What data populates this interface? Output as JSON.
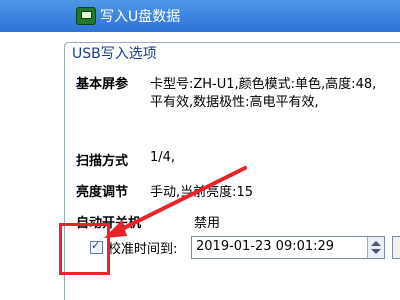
{
  "window": {
    "title": "写入U盘数据",
    "icon": "app-icon"
  },
  "group": {
    "title": "USB写入选项"
  },
  "fields": {
    "basic_params": {
      "label": "基本屏参",
      "value_line1": "卡型号:ZH-U1,颜色模式:单色,高度:48,",
      "value_line2": "平有效,数据极性:高电平有效,"
    },
    "scan_mode": {
      "label": "扫描方式",
      "value": "1/4,"
    },
    "brightness": {
      "label": "亮度调节",
      "value": "手动,当前亮度:15"
    },
    "auto_onoff": {
      "label": "自动开关机",
      "value": "禁用"
    }
  },
  "calibrate": {
    "checked": true,
    "label": "校准时间到:",
    "datetime": "2019-01-23   09:01:29"
  },
  "annotation": {
    "color": "#e8232a"
  }
}
